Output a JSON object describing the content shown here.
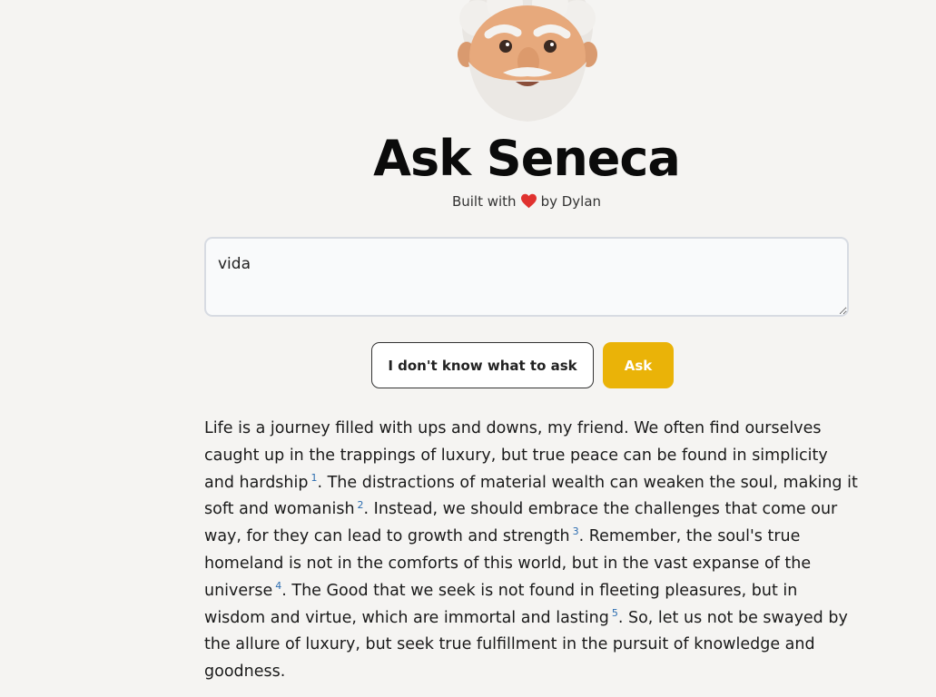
{
  "header": {
    "title": "Ask Seneca",
    "credit_prefix": "Built with",
    "credit_suffix": "by Dylan"
  },
  "form": {
    "question_value": "vida",
    "idk_label": "I don't know what to ask",
    "ask_label": "Ask"
  },
  "answer": {
    "segments": [
      "Life is a journey filled with ups and downs, my friend. We often find ourselves caught up in the trappings of luxury, but true peace can be found in simplicity and hardship",
      ". The distractions of material wealth can weaken the soul, making it soft and womanish",
      ". Instead, we should embrace the challenges that come our way, for they can lead to growth and strength",
      ". Remember, the soul's true homeland is not in the comforts of this world, but in the vast expanse of the universe",
      ". The Good that we seek is not found in fleeting pleasures, but in wisdom and virtue, which are immortal and lasting",
      ". So, let us not be swayed by the allure of luxury, but seek true fulfillment in the pursuit of knowledge and goodness."
    ],
    "citations": [
      "1",
      "2",
      "3",
      "4",
      "5"
    ]
  },
  "colors": {
    "background": "#f5f4f2",
    "accent": "#eab308",
    "citation": "#2b6cb0"
  },
  "icons": {
    "avatar": "seneca-avatar-icon",
    "heart": "heart-icon"
  }
}
